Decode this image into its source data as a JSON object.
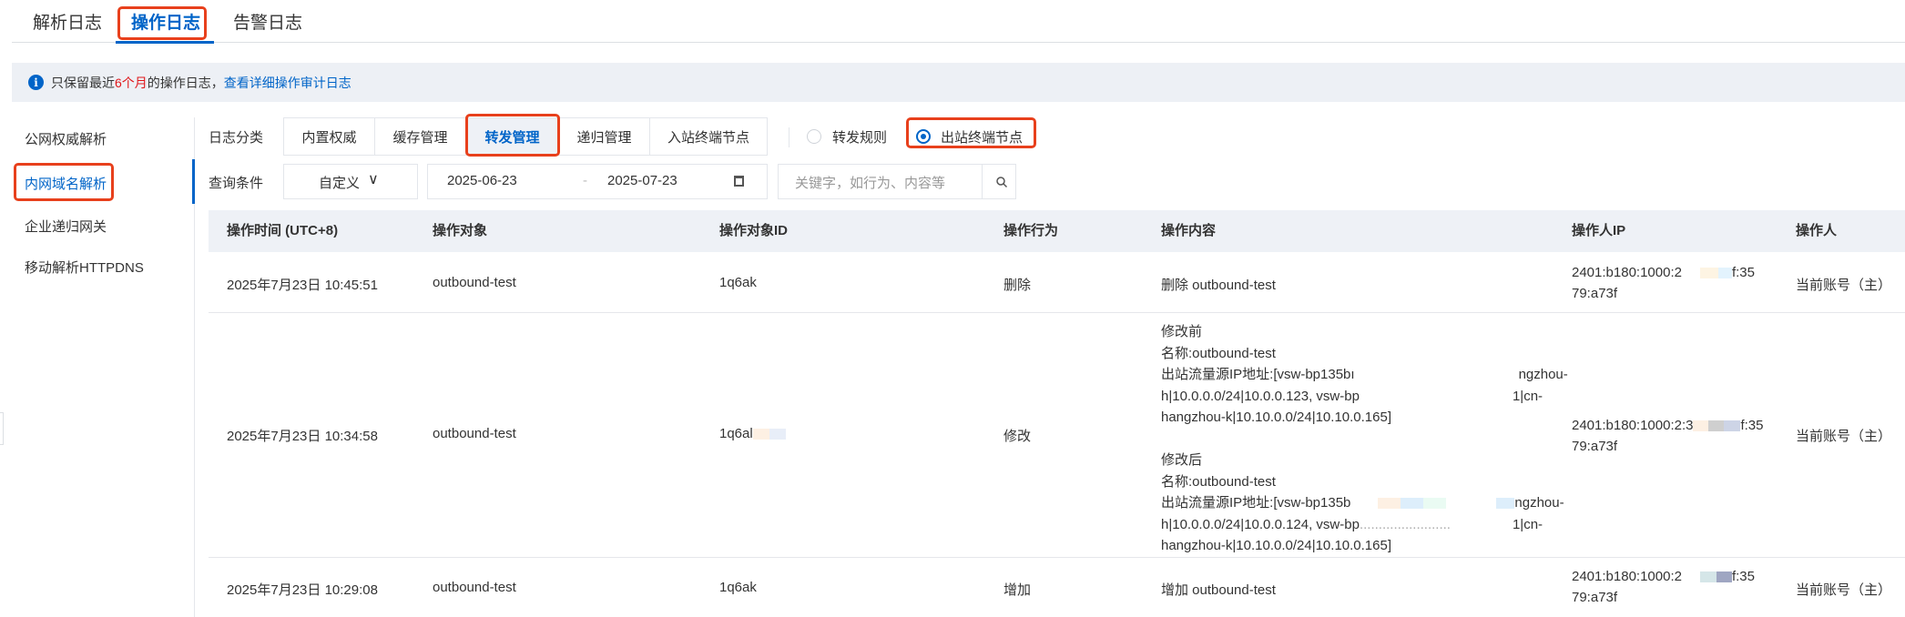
{
  "tabs": [
    {
      "label": "解析日志"
    },
    {
      "label": "操作日志",
      "active": true
    },
    {
      "label": "告警日志"
    }
  ],
  "notice": {
    "prefix": "只保留最近",
    "highlight": "6个月",
    "suffix": "的操作日志，",
    "link": "查看详细操作审计日志",
    "icon": "info-icon"
  },
  "sidebar": {
    "items": [
      {
        "label": "公网权威解析"
      },
      {
        "label": "内网域名解析",
        "active": true
      },
      {
        "label": "企业递归网关"
      },
      {
        "label": "移动解析HTTPDNS"
      }
    ]
  },
  "filters": {
    "category_label": "日志分类",
    "categories": [
      "内置权威",
      "缓存管理",
      "转发管理",
      "递归管理",
      "入站终端节点"
    ],
    "active_category": "转发管理",
    "radios": [
      {
        "label": "转发规则",
        "checked": false
      },
      {
        "label": "出站终端节点",
        "checked": true
      }
    ],
    "query_label": "查询条件",
    "range_select": "自定义",
    "start_date": "2025-06-23",
    "date_sep": "-",
    "end_date": "2025-07-23",
    "search_placeholder": "关键字，如行为、内容等"
  },
  "table": {
    "columns": [
      "操作时间 (UTC+8)",
      "操作对象",
      "操作对象ID",
      "操作行为",
      "操作内容",
      "操作人IP",
      "操作人"
    ],
    "rows": [
      {
        "time": "2025年7月23日 10:45:51",
        "object": "outbound-test",
        "id": "1q6ak",
        "action": "删除",
        "content": [
          "删除 outbound-test"
        ],
        "ip1": "2401:b180:1000:2",
        "ip1b": "f:35",
        "ip2": "79:a73f",
        "operator": "当前账号（主）"
      },
      {
        "time": "2025年7月23日 10:34:58",
        "object": "outbound-test",
        "id": "1q6al",
        "action": "修改",
        "content": [
          "修改前",
          "名称:outbound-test",
          "出站流量源IP地址:[vsw-bp135bı",
          "ngzhou-",
          "h|10.0.0.0/24|10.0.0.123, vsw-bp",
          "1|cn-",
          "hangzhou-k|10.10.0.0/24|10.10.0.165]",
          "修改后",
          "名称:outbound-test",
          "出站流量源IP地址:[vsw-bp135b",
          "ngzhou-",
          "h|10.0.0.0/24|10.0.0.124, vsw-bp",
          "1|cn-",
          "hangzhou-k|10.10.0.0/24|10.10.0.165]"
        ],
        "ip1": "2401:b180:1000:2:3",
        "ip1b": "f:35",
        "ip2": "79:a73f",
        "operator": "当前账号（主）"
      },
      {
        "time": "2025年7月23日 10:29:08",
        "object": "outbound-test",
        "id": "1q6ak",
        "action": "增加",
        "content": [
          "增加 outbound-test"
        ],
        "ip1": "2401:b180:1000:2",
        "ip1b": "f:35",
        "ip2": "79:a73f",
        "operator": "当前账号（主）"
      }
    ]
  },
  "colors": {
    "accent": "#0064c8",
    "highlight_box": "#e8401c",
    "header_bg": "#eef1f6"
  }
}
